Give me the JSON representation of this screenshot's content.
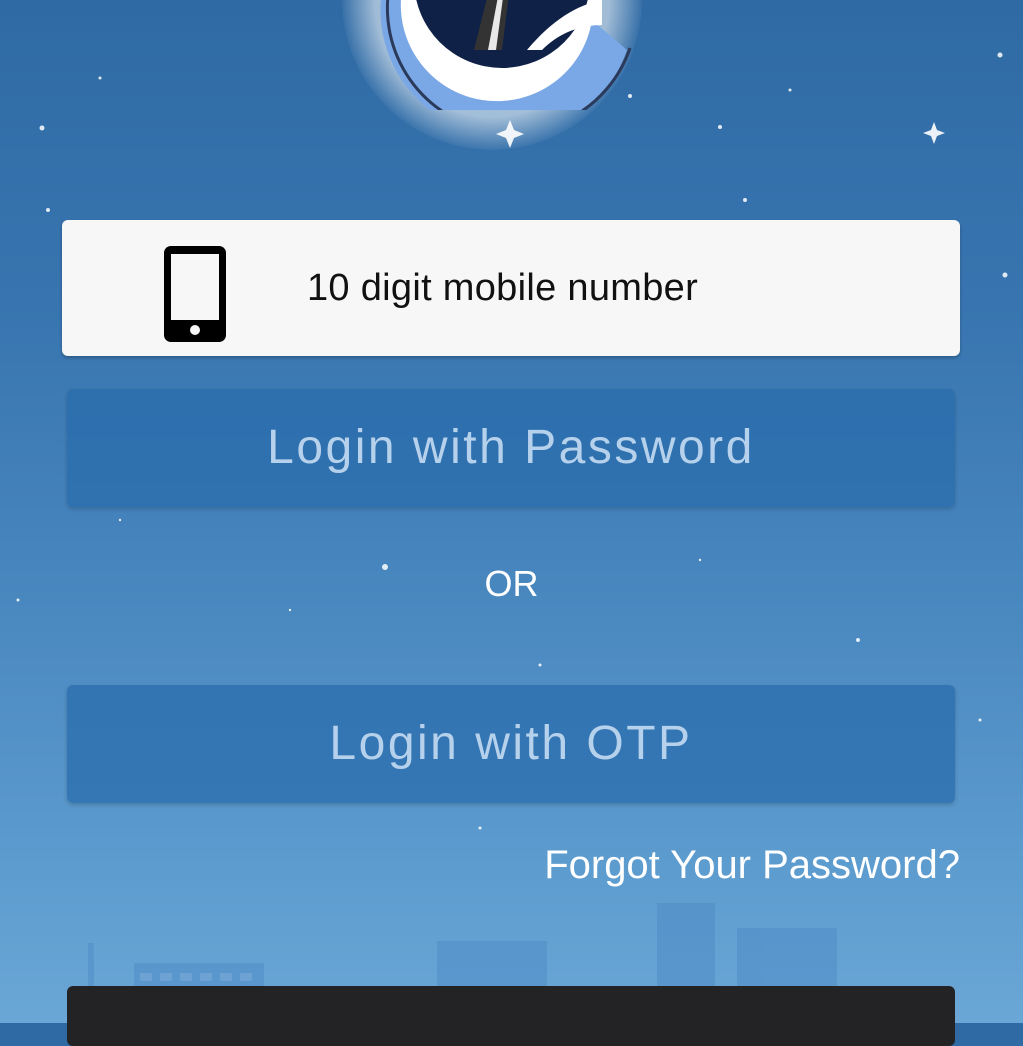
{
  "form": {
    "mobile_placeholder": "10 digit mobile number",
    "login_password_label": "Login with Password",
    "or_label": "OR",
    "login_otp_label": "Login with OTP",
    "forgot_password_label": "Forgot Your Password?"
  },
  "icons": {
    "logo": "app-logo",
    "phone": "smartphone-icon"
  },
  "colors": {
    "background_top": "#2f6aa4",
    "background_bottom": "#6aa7d6",
    "button_fill": "#2a6cac",
    "button_text": "#bed6ee",
    "input_fill": "#f7f7f7",
    "bottom_bar": "#232326"
  }
}
